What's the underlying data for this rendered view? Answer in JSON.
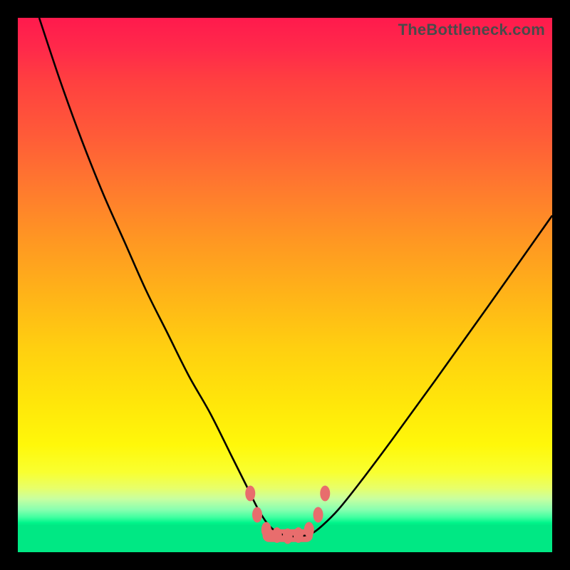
{
  "watermark": "TheBottleneck.com",
  "chart_data": {
    "type": "line",
    "title": "",
    "xlabel": "",
    "ylabel": "",
    "xlim": [
      0,
      100
    ],
    "ylim": [
      0,
      100
    ],
    "series": [
      {
        "name": "bottleneck-curve",
        "x": [
          4,
          8,
          12,
          16,
          20,
          24,
          28,
          32,
          36,
          40,
          43,
          45,
          47,
          49,
          51,
          53,
          55,
          57,
          60,
          64,
          70,
          78,
          88,
          100
        ],
        "values": [
          100,
          88,
          77,
          67,
          58,
          49,
          41,
          33,
          26,
          18,
          12,
          8,
          5,
          3.5,
          3,
          3,
          3.5,
          5,
          8,
          13,
          21,
          32,
          46,
          63
        ]
      }
    ],
    "markers": [
      {
        "x": 43.5,
        "y": 11
      },
      {
        "x": 44.8,
        "y": 7
      },
      {
        "x": 46.5,
        "y": 4.2
      },
      {
        "x": 48.5,
        "y": 3.2
      },
      {
        "x": 50.5,
        "y": 3.0
      },
      {
        "x": 52.5,
        "y": 3.2
      },
      {
        "x": 54.5,
        "y": 4.2
      },
      {
        "x": 56.2,
        "y": 7
      },
      {
        "x": 57.5,
        "y": 11
      }
    ],
    "trough_band": {
      "x_start": 47,
      "x_end": 54,
      "y": 3.1,
      "thickness": 1.2
    },
    "colors": {
      "curve": "#000000",
      "markers": "#e86d6d",
      "trough_band": "#e86d6d"
    }
  }
}
